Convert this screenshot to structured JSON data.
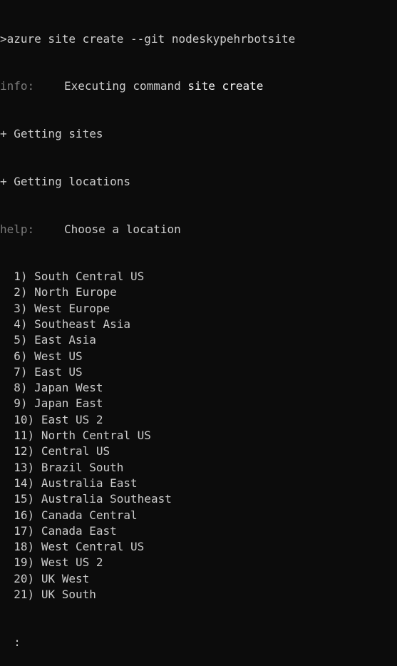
{
  "terminal": {
    "prompt_line": ">azure site create --git nodeskypehrbotsite",
    "info_label": "info:",
    "info_text_prefix": "Executing command ",
    "info_text_cmd": "site create",
    "progress": [
      "+ Getting sites",
      "+ Getting locations"
    ],
    "help_label": "help:",
    "help_text": "Choose a location",
    "locations": [
      {
        "num": "1)",
        "name": "South Central US"
      },
      {
        "num": "2)",
        "name": "North Europe"
      },
      {
        "num": "3)",
        "name": "West Europe"
      },
      {
        "num": "4)",
        "name": "Southeast Asia"
      },
      {
        "num": "5)",
        "name": "East Asia"
      },
      {
        "num": "6)",
        "name": "West US"
      },
      {
        "num": "7)",
        "name": "East US"
      },
      {
        "num": "8)",
        "name": "Japan West"
      },
      {
        "num": "9)",
        "name": "Japan East"
      },
      {
        "num": "10)",
        "name": "East US 2"
      },
      {
        "num": "11)",
        "name": "North Central US"
      },
      {
        "num": "12)",
        "name": "Central US"
      },
      {
        "num": "13)",
        "name": "Brazil South"
      },
      {
        "num": "14)",
        "name": "Australia East"
      },
      {
        "num": "15)",
        "name": "Australia Southeast"
      },
      {
        "num": "16)",
        "name": "Canada Central"
      },
      {
        "num": "17)",
        "name": "Canada East"
      },
      {
        "num": "18)",
        "name": "West Central US"
      },
      {
        "num": "19)",
        "name": "West US 2"
      },
      {
        "num": "20)",
        "name": "UK West"
      },
      {
        "num": "21)",
        "name": "UK South"
      }
    ],
    "input_prompt": ":"
  },
  "colors": {
    "background": "#0c0c0c",
    "text": "#cccccc",
    "dim_label": "#7a7a7a",
    "bright": "#f2f2f2"
  }
}
